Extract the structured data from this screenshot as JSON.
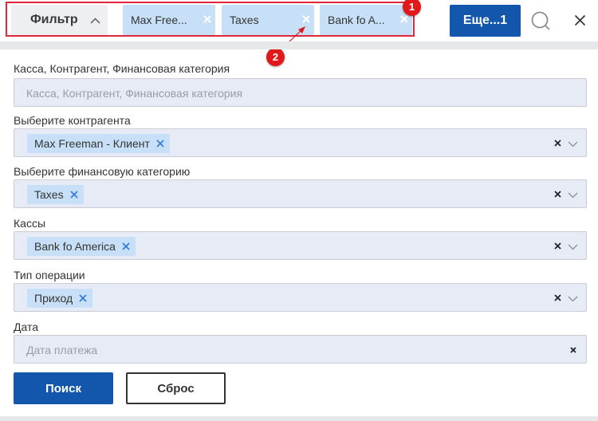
{
  "topbar": {
    "filter_label": "Фильтр",
    "chips": [
      {
        "label": "Max Free..."
      },
      {
        "label": "Taxes"
      },
      {
        "label": "Bank fo A..."
      }
    ],
    "more_label": "Еще...1"
  },
  "annotations": {
    "badge1": "1",
    "badge2": "2"
  },
  "form": {
    "fields": [
      {
        "label": "Касса, Контрагент, Финансовая категория",
        "placeholder": "Касса, Контрагент, Финансовая категория"
      },
      {
        "label": "Выберите контрагента",
        "chip": "Max Freeman - Клиент"
      },
      {
        "label": "Выберите финансовую категорию",
        "chip": "Taxes"
      },
      {
        "label": "Кассы",
        "chip": "Bank fo America"
      },
      {
        "label": "Тип операции",
        "chip": "Приход"
      },
      {
        "label": "Дата",
        "placeholder": "Дата платежа"
      }
    ],
    "search_button": "Поиск",
    "reset_button": "Сброс"
  },
  "colors": {
    "primary": "#1357ad",
    "chip_bg": "#c8e0f7",
    "field_bg": "#e6ebf6",
    "highlight": "#e0263b"
  }
}
